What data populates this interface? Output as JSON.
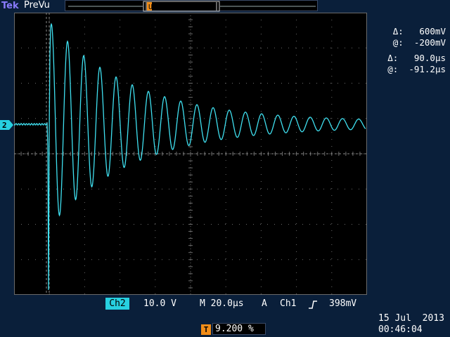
{
  "header": {
    "brand": "Tek",
    "mode": "PreVu",
    "trigger_pos_icon": "trigger-position-icon"
  },
  "screen": {
    "trace_color": "#3fe0f0",
    "grid_color": "#6a6a6a",
    "trigger_marker_label": "T",
    "channel_marker_label": "2"
  },
  "cursors": {
    "voltage_delta_label": "Δ:",
    "voltage_delta": "600mV",
    "voltage_at_label": "@:",
    "voltage_at": "-200mV",
    "time_delta_label": "Δ:",
    "time_delta": "90.0µs",
    "time_at_label": "@:",
    "time_at": "-91.2µs"
  },
  "status": {
    "channel_badge": "Ch2",
    "volts_per_div": "10.0 V",
    "timebase": "M 20.0µs",
    "trigger_mode": "A",
    "trigger_source": "Ch1",
    "trigger_slope_icon": "rising-edge-icon",
    "trigger_level": "398mV",
    "trigger_position_badge": "T",
    "trigger_position": "9.200 %",
    "date": "15 Jul  2013",
    "time": "00:46:04"
  }
}
